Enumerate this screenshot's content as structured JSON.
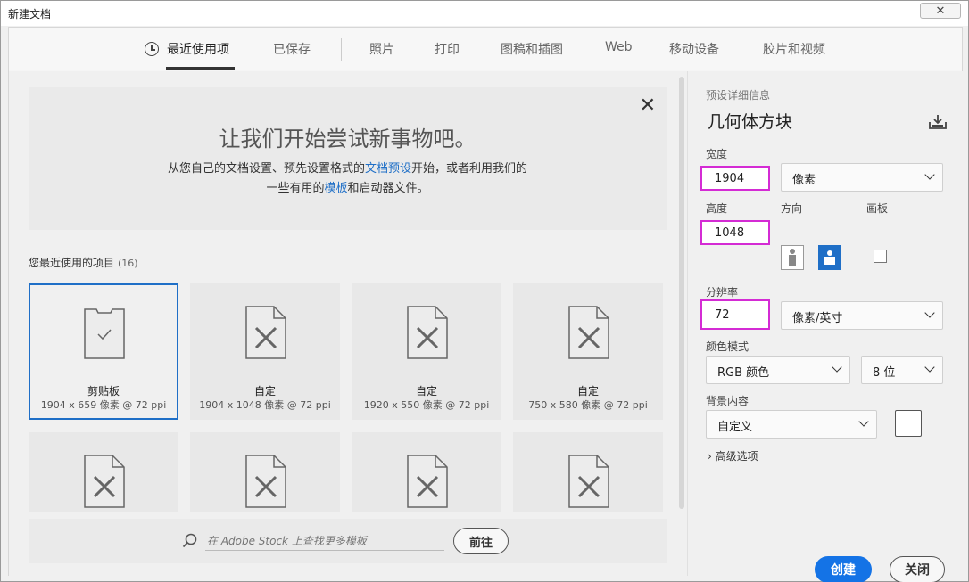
{
  "window": {
    "title": "新建文档",
    "close_glyph": "✕"
  },
  "tabs": [
    {
      "label": "最近使用项"
    },
    {
      "label": "已保存"
    },
    {
      "label": "照片"
    },
    {
      "label": "打印"
    },
    {
      "label": "图稿和插图"
    },
    {
      "label": "Web"
    },
    {
      "label": "移动设备"
    },
    {
      "label": "胶片和视频"
    }
  ],
  "hero": {
    "title": "让我们开始尝试新事物吧。",
    "line1_a": "从您自己的文档设置、预先设置格式的",
    "line1_link": "文档预设",
    "line1_b": "开始，或者利用我们的",
    "line2_a": "一些有用的",
    "line2_link": "模板",
    "line2_b": "和启动器文件。",
    "close_glyph": "✕"
  },
  "recent": {
    "label": "您最近使用的项目",
    "count": "(16)",
    "items": [
      {
        "name": "剪贴板",
        "meta": "1904 x 659 像素 @ 72 ppi"
      },
      {
        "name": "自定",
        "meta": "1904 x 1048 像素 @ 72 ppi"
      },
      {
        "name": "自定",
        "meta": "1920 x 550 像素 @ 72 ppi"
      },
      {
        "name": "自定",
        "meta": "750 x 580 像素 @ 72 ppi"
      }
    ]
  },
  "stock": {
    "placeholder": "在 Adobe Stock 上查找更多模板",
    "go_label": "前往"
  },
  "details": {
    "section_label": "预设详细信息",
    "preset_name": "几何体方块",
    "width_label": "宽度",
    "width_value": "1904",
    "width_unit": "像素",
    "height_label": "高度",
    "height_value": "1048",
    "orientation_label": "方向",
    "artboard_label": "画板",
    "resolution_label": "分辨率",
    "resolution_value": "72",
    "resolution_unit": "像素/英寸",
    "color_mode_label": "颜色模式",
    "color_mode_value": "RGB 颜色",
    "bit_depth_value": "8 位",
    "background_label": "背景内容",
    "background_value": "自定义",
    "advanced_label": "高级选项",
    "create_label": "创建",
    "close_label": "关闭"
  }
}
